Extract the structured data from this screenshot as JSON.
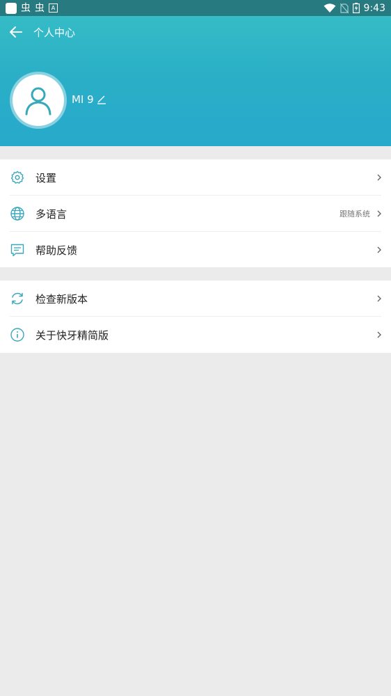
{
  "status_bar": {
    "time": "9:43",
    "left_glyphs": [
      "虫",
      "虫"
    ],
    "a_badge": "A"
  },
  "header": {
    "title": "个人中心",
    "username": "MI 9"
  },
  "menu_group1": [
    {
      "label": "设置",
      "value": ""
    },
    {
      "label": "多语言",
      "value": "跟随系统"
    },
    {
      "label": "帮助反馈",
      "value": ""
    }
  ],
  "menu_group2": [
    {
      "label": "检查新版本",
      "value": ""
    },
    {
      "label": "关于快牙精简版",
      "value": ""
    }
  ],
  "colors": {
    "accent": "#2aafc7",
    "status_bar": "#267a80",
    "icon": "#3aa7bd"
  }
}
